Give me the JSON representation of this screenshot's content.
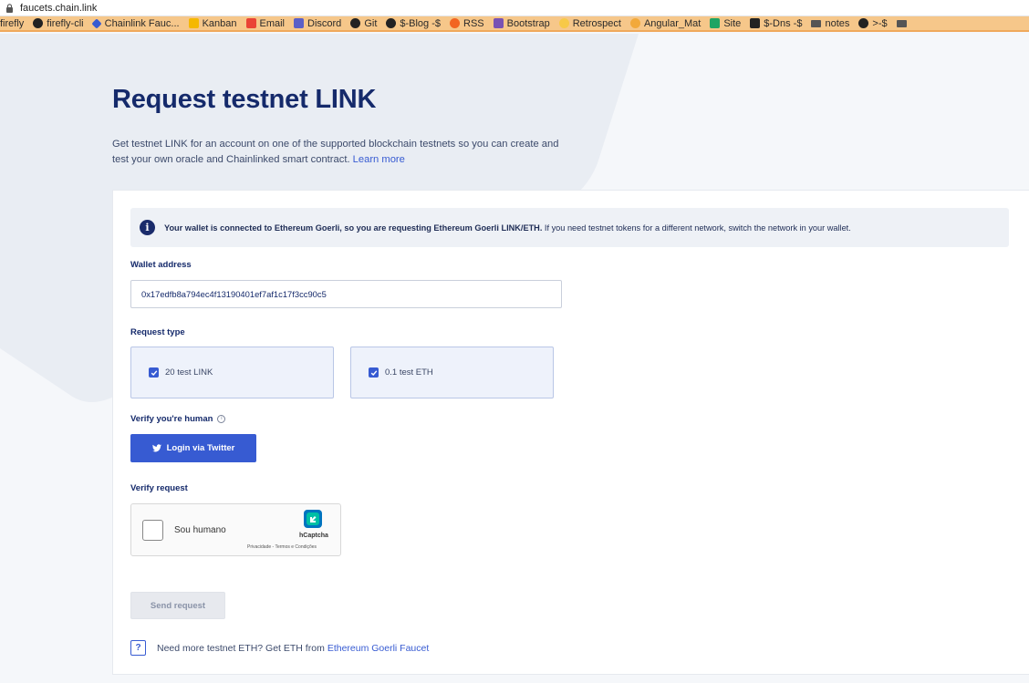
{
  "browser": {
    "url": "faucets.chain.link",
    "bookmarks": [
      {
        "label": "firefly",
        "icon": "none"
      },
      {
        "label": "firefly-cli",
        "icon": "gh"
      },
      {
        "label": "Chainlink Fauc...",
        "icon": "chainlink"
      },
      {
        "label": "Kanban",
        "icon": "kanban"
      },
      {
        "label": "Email",
        "icon": "gmail"
      },
      {
        "label": "Discord",
        "icon": "teams"
      },
      {
        "label": "Git",
        "icon": "gh"
      },
      {
        "label": "$-Blog -$",
        "icon": "gh"
      },
      {
        "label": "RSS",
        "icon": "rss"
      },
      {
        "label": "Bootstrap",
        "icon": "bootstrap"
      },
      {
        "label": "Retrospect",
        "icon": "retro"
      },
      {
        "label": "Angular_Mat",
        "icon": "angular"
      },
      {
        "label": "Site",
        "icon": "drive"
      },
      {
        "label": "$-Dns -$",
        "icon": "ncode"
      },
      {
        "label": "notes",
        "icon": "folder"
      },
      {
        "label": ">-$",
        "icon": "gh"
      },
      {
        "label": "",
        "icon": "folder"
      }
    ]
  },
  "page": {
    "title": "Request testnet LINK",
    "intro_text": "Get testnet LINK for an account on one of the supported blockchain testnets so you can create and test your own oracle and Chainlinked smart contract.",
    "learn_more": "Learn more"
  },
  "info": {
    "bold_text": "Your wallet is connected to Ethereum Goerli, so you are requesting Ethereum Goerli LINK/ETH.",
    "rest_text": " If you need testnet tokens for a different network, switch the network in your wallet."
  },
  "form": {
    "wallet_label": "Wallet address",
    "wallet_value": "0x17edfb8a794ec4f13190401ef7af1c17f3cc90c5",
    "request_type_label": "Request type",
    "request_options": [
      {
        "label": "20 test LINK",
        "checked": true
      },
      {
        "label": "0.1 test ETH",
        "checked": true
      }
    ],
    "verify_human_label": "Verify you're human",
    "twitter_button": "Login via Twitter",
    "verify_request_label": "Verify request",
    "captcha_label": "Sou humano",
    "captcha_brand": "hCaptcha",
    "captcha_links": "Privacidade - Termos e Condições",
    "send_button": "Send request"
  },
  "footer": {
    "text": "Need more testnet ETH? Get ETH from",
    "link": "Ethereum Goerli Faucet"
  },
  "colors": {
    "brand_blue": "#375bd2",
    "title_navy": "#152a6b",
    "bookmark_bar": "#f6c78a"
  }
}
